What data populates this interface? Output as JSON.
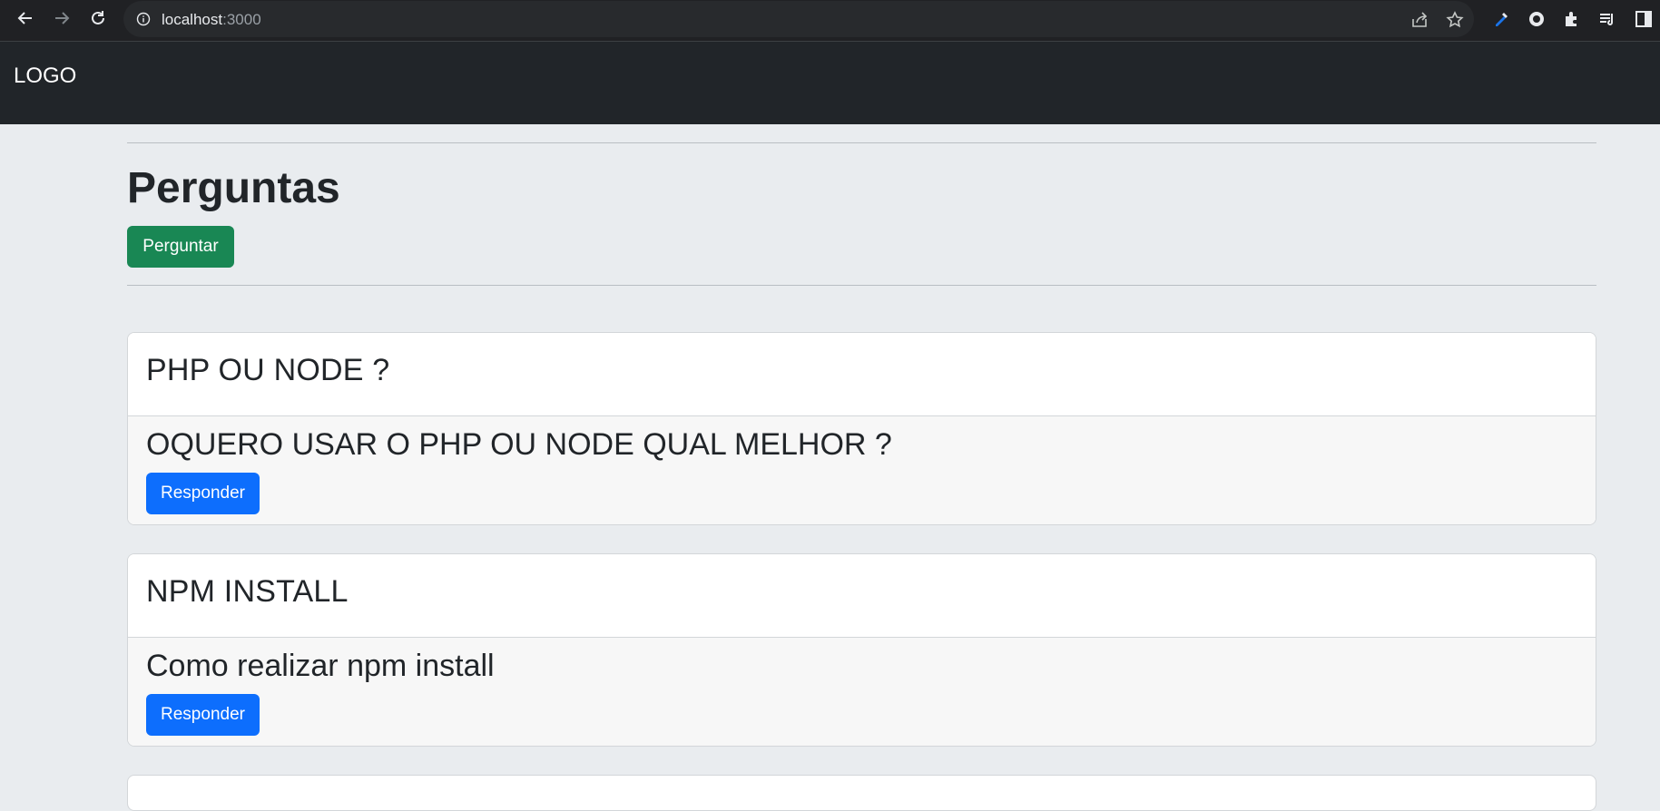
{
  "browser": {
    "url_host": "localhost",
    "url_port": ":3000"
  },
  "navbar": {
    "logo": "LOGO"
  },
  "page": {
    "title": "Perguntas",
    "ask_button": "Perguntar"
  },
  "questions": [
    {
      "title": "PHP OU NODE ?",
      "description": "OQUERO USAR O PHP OU NODE QUAL MELHOR ?",
      "reply_button": "Responder"
    },
    {
      "title": "NPM INSTALL",
      "description": "Como realizar npm install",
      "reply_button": "Responder"
    }
  ],
  "colors": {
    "navbar_bg": "#212529",
    "page_bg": "#e9ecef",
    "success": "#198754",
    "primary": "#0d6efd"
  }
}
